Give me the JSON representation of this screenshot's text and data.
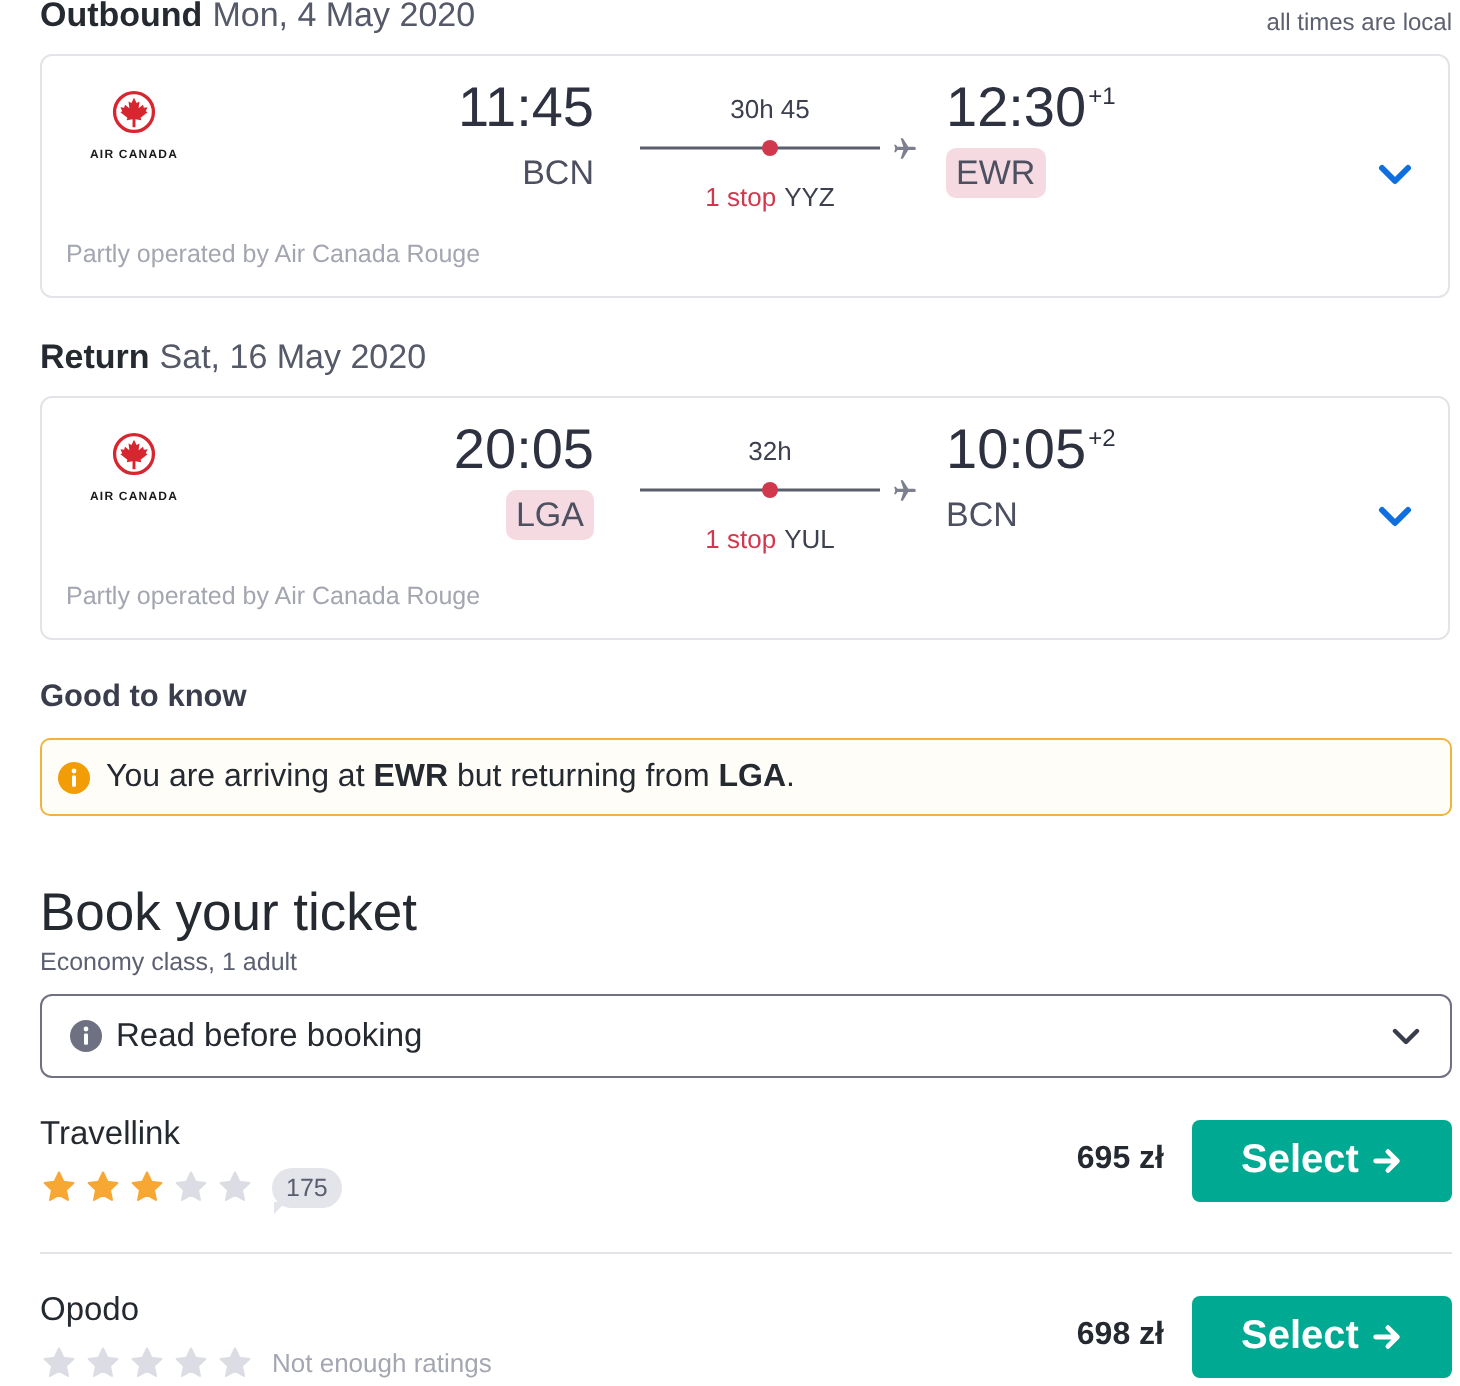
{
  "legs": [
    {
      "label": "Outbound",
      "date": "Mon, 4 May 2020",
      "note": "all times are local",
      "flight": {
        "airline_logo_text": "AIR CANADA",
        "departure": {
          "time": "11:45",
          "airport": "BCN",
          "highlighted": false
        },
        "duration": "30h 45",
        "stops": "1 stop",
        "stop_airport": "YYZ",
        "arrival": {
          "time": "12:30",
          "day_offset": "+1",
          "airport": "EWR",
          "highlighted": true
        },
        "operator_note": "Partly operated by Air Canada Rouge"
      }
    },
    {
      "label": "Return",
      "date": "Sat, 16 May 2020",
      "flight": {
        "airline_logo_text": "AIR CANADA",
        "departure": {
          "time": "20:05",
          "airport": "LGA",
          "highlighted": true
        },
        "duration": "32h",
        "stops": "1 stop",
        "stop_airport": "YUL",
        "arrival": {
          "time": "10:05",
          "day_offset": "+2",
          "airport": "BCN",
          "highlighted": false
        },
        "operator_note": "Partly operated by Air Canada Rouge"
      }
    }
  ],
  "good_to_know": {
    "title": "Good to know",
    "message": "You are arriving at **EWR** but returning from **LGA**."
  },
  "booking": {
    "title": "Book your ticket",
    "subtitle": "Economy class, 1 adult",
    "info_dropdown": "Read before booking"
  },
  "providers": [
    {
      "name": "Travellink",
      "stars": 3,
      "rating_count": "175",
      "price": "695 zł",
      "button": "Select"
    },
    {
      "name": "Opodo",
      "stars": 0,
      "rating_note": "Not enough ratings",
      "price": "698 zł",
      "button": "Select"
    }
  ]
}
